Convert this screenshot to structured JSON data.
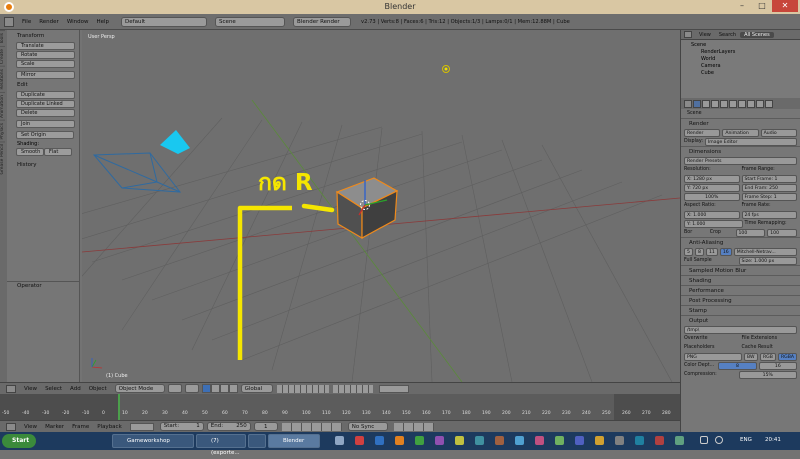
{
  "window": {
    "title": "Blender",
    "minimize": "–",
    "maximize": "□",
    "close": "✕"
  },
  "infobar": {
    "menus": [
      "File",
      "Render",
      "Window",
      "Help"
    ],
    "layout": "Default",
    "scene": "Scene",
    "engine": "Blender Render",
    "stats": "v2.73 | Verts:8 | Faces:6 | Tris:12 | Objects:1/3 | Lamps:0/1 | Mem:12.88M | Cube"
  },
  "tool_tabs": [
    "Tools",
    "Create",
    "Relations",
    "Animation",
    "Physics",
    "Grease Pencil"
  ],
  "toolshelf": {
    "transform_head": "Transform",
    "transform": [
      "Translate",
      "Rotate",
      "Scale",
      "Mirror"
    ],
    "edit_head": "Edit",
    "edit": [
      "Duplicate",
      "Duplicate Linked",
      "Delete",
      "Join"
    ],
    "set_origin": "Set Origin",
    "shading_label": "Shading:",
    "smooth": "Smooth",
    "flat": "Flat",
    "history": "History",
    "operator": "Operator"
  },
  "viewport": {
    "label": "User Persp",
    "object_label": "(1) Cube",
    "annotation": "กด R"
  },
  "vp_header": {
    "menus": [
      "View",
      "Select",
      "Add",
      "Object"
    ],
    "mode": "Object Mode",
    "orientation": "Global"
  },
  "timeline": {
    "ticks": [
      "-50",
      "-40",
      "-30",
      "-20",
      "-10",
      "0",
      "10",
      "20",
      "30",
      "40",
      "50",
      "60",
      "70",
      "80",
      "90",
      "100",
      "110",
      "120",
      "130",
      "140",
      "150",
      "160",
      "170",
      "180",
      "190",
      "200",
      "210",
      "220",
      "230",
      "240",
      "250",
      "260",
      "270",
      "280"
    ]
  },
  "tl_header": {
    "menus": [
      "View",
      "Marker",
      "Frame",
      "Playback"
    ],
    "start": "Start:",
    "start_val": "1",
    "end": "End:",
    "end_val": "250",
    "current": "1",
    "sync": "No Sync"
  },
  "outliner": {
    "menus": [
      "View",
      "Search",
      "All Scenes"
    ],
    "items": [
      "Scene",
      "RenderLayers",
      "World",
      "Camera",
      "Cube"
    ]
  },
  "props": {
    "scene_label": "Scene",
    "render_head": "Render",
    "render_btn": "Render",
    "animation_btn": "Animation",
    "audio_btn": "Audio",
    "display_label": "Display:",
    "display_val": "Image Editor",
    "dimensions_head": "Dimensions",
    "presets": "Render Presets",
    "resolution": "Resolution:",
    "x_val": "X: 1280 px",
    "y_val": "Y: 720 px",
    "pct": "100%",
    "frame_range": "Frame Range:",
    "start_frame": "Start Frame: 1",
    "end_frame": "End Fram: 250",
    "frame_step": "Frame Step: 1",
    "aspect": "Aspect Ratio:",
    "ax": "X: 1.000",
    "ay": "Y: 1.000",
    "fps_label": "Frame Rate:",
    "fps": "24 fps",
    "remap": "Time Remapping:",
    "remap_a": "100",
    "remap_b": "100",
    "bor": "Bor",
    "crop": "Crop",
    "aa_head": "Anti-Aliasing",
    "aa_samples": [
      "5",
      "8",
      "11",
      "16"
    ],
    "filter": "Mitchell-Netrav...",
    "full_sample": "Full Sample",
    "size": "Size: 1.000 px",
    "smb": "Sampled Motion Blur",
    "shading": "Shading",
    "performance": "Performance",
    "post": "Post Processing",
    "stamp": "Stamp",
    "output_head": "Output",
    "output_path": "/tmp\\",
    "overwrite": "Overwrite",
    "file_ext": "File Extensions",
    "placeholders": "Placeholders",
    "cache": "Cache Result",
    "format": "PNG",
    "bw": "BW",
    "rgb": "RGB",
    "rgba": "RGBA",
    "color_depth": "Color Dept...",
    "cd8": "8",
    "cd16": "16",
    "compression": "Compression:",
    "compression_val": "15%"
  },
  "taskbar": {
    "start": "Start",
    "apps": [
      "Gameworkshop",
      "(7) (exporte...",
      "",
      "Blender"
    ],
    "lang": "ENG",
    "time": "20:41"
  }
}
